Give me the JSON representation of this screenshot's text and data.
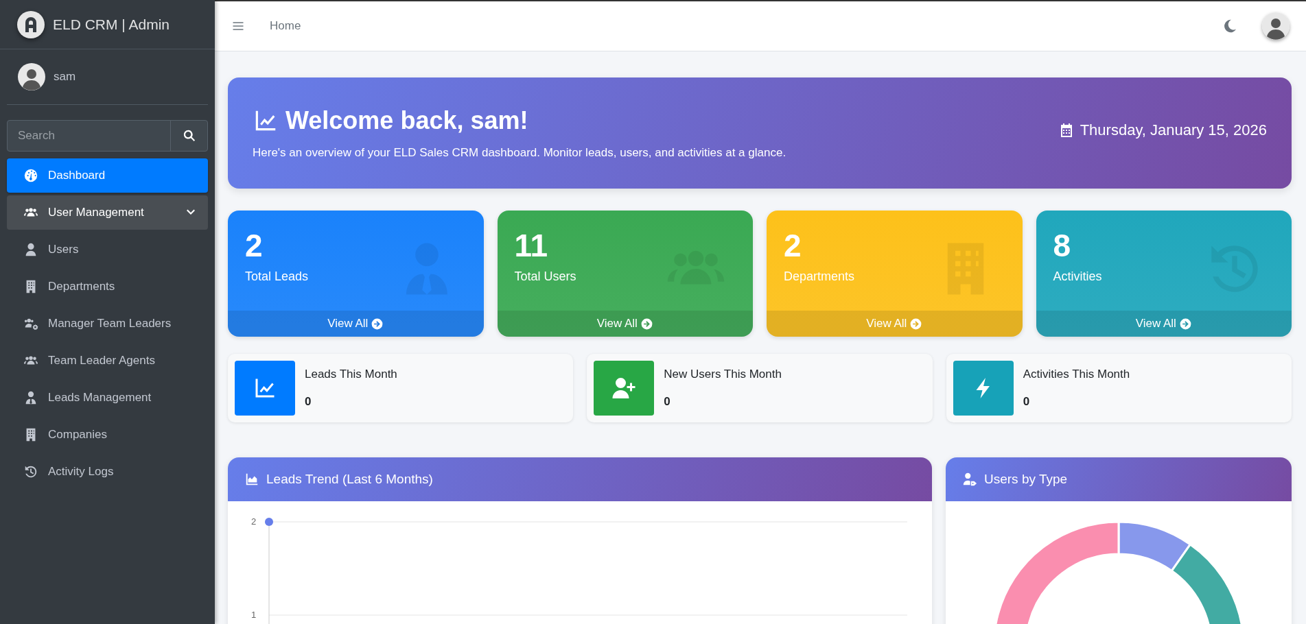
{
  "sidebar": {
    "brand": "ELD CRM | Admin",
    "user": {
      "name": "sam"
    },
    "search": {
      "placeholder": "Search"
    },
    "items": [
      {
        "label": "Dashboard",
        "selected": true,
        "expanded": false
      },
      {
        "label": "User Management",
        "selected": false,
        "expanded": true
      },
      {
        "label": "Users",
        "selected": false,
        "expanded": false
      },
      {
        "label": "Departments",
        "selected": false,
        "expanded": false
      },
      {
        "label": "Manager Team Leaders",
        "selected": false,
        "expanded": false
      },
      {
        "label": "Team Leader Agents",
        "selected": false,
        "expanded": false
      },
      {
        "label": "Leads Management",
        "selected": false,
        "expanded": false
      },
      {
        "label": "Companies",
        "selected": false,
        "expanded": false
      },
      {
        "label": "Activity Logs",
        "selected": false,
        "expanded": false
      }
    ]
  },
  "topbar": {
    "breadcrumb": "Home"
  },
  "welcome": {
    "title": "Welcome back, sam!",
    "subtitle": "Here's an overview of your ELD Sales CRM dashboard. Monitor leads, users, and activities at a glance.",
    "date": "Thursday, January 15, 2026"
  },
  "stat_cards": [
    {
      "value": "2",
      "label": "Total Leads",
      "link": "View All",
      "color": "#1a82fb"
    },
    {
      "value": "11",
      "label": "Total Users",
      "link": "View All",
      "color": "#3aa953"
    },
    {
      "value": "2",
      "label": "Departments",
      "link": "View All",
      "color": "#fdc11a"
    },
    {
      "value": "8",
      "label": "Activities",
      "link": "View All",
      "color": "#20a7bc"
    }
  ],
  "info_boxes": [
    {
      "label": "Leads This Month",
      "value": "0",
      "color": "#007bff"
    },
    {
      "label": "New Users This Month",
      "value": "0",
      "color": "#28a745"
    },
    {
      "label": "Activities This Month",
      "value": "0",
      "color": "#17a2b8"
    }
  ],
  "charts": [
    {
      "title": "Leads Trend (Last 6 Months)",
      "y_tick_labels": [
        "2",
        "1"
      ]
    },
    {
      "title": "Users by Type"
    }
  ]
}
